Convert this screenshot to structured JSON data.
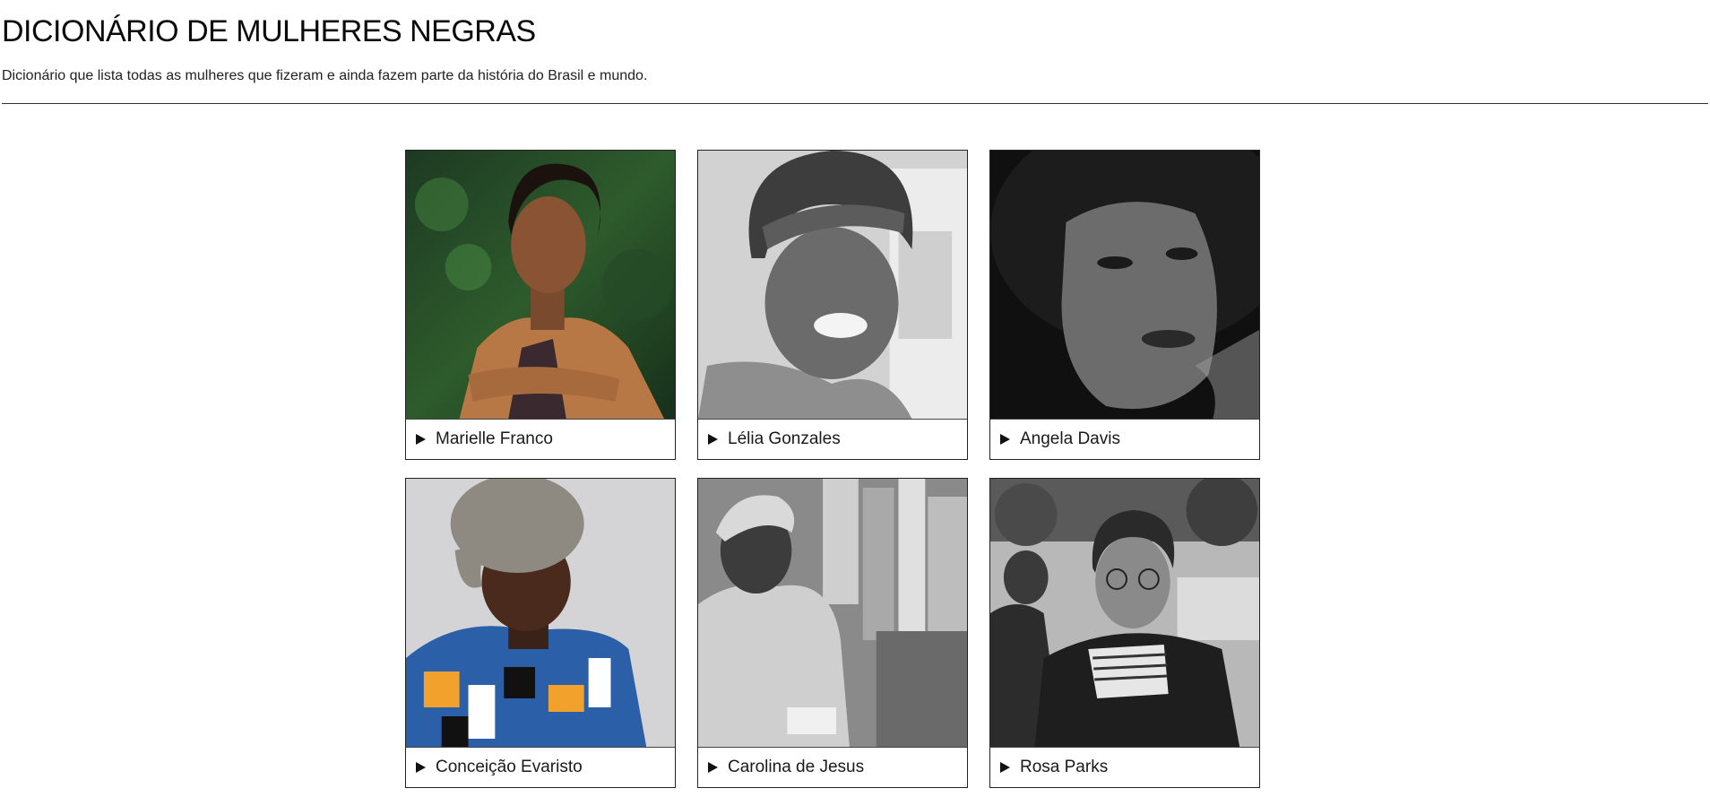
{
  "header": {
    "title": "DICIONÁRIO DE MULHERES NEGRAS",
    "subtitle": "Dicionário que lista todas as mulheres que fizeram e ainda fazem parte da história do Brasil e mundo."
  },
  "cards": [
    {
      "name": "Marielle Franco"
    },
    {
      "name": "Lélia Gonzales"
    },
    {
      "name": "Angela Davis"
    },
    {
      "name": "Conceição Evaristo"
    },
    {
      "name": "Carolina de Jesus"
    },
    {
      "name": "Rosa Parks"
    }
  ],
  "icons": {
    "expand": "play-triangle-icon"
  },
  "colors": {
    "text": "#111111",
    "border": "#222222",
    "background": "#ffffff"
  }
}
